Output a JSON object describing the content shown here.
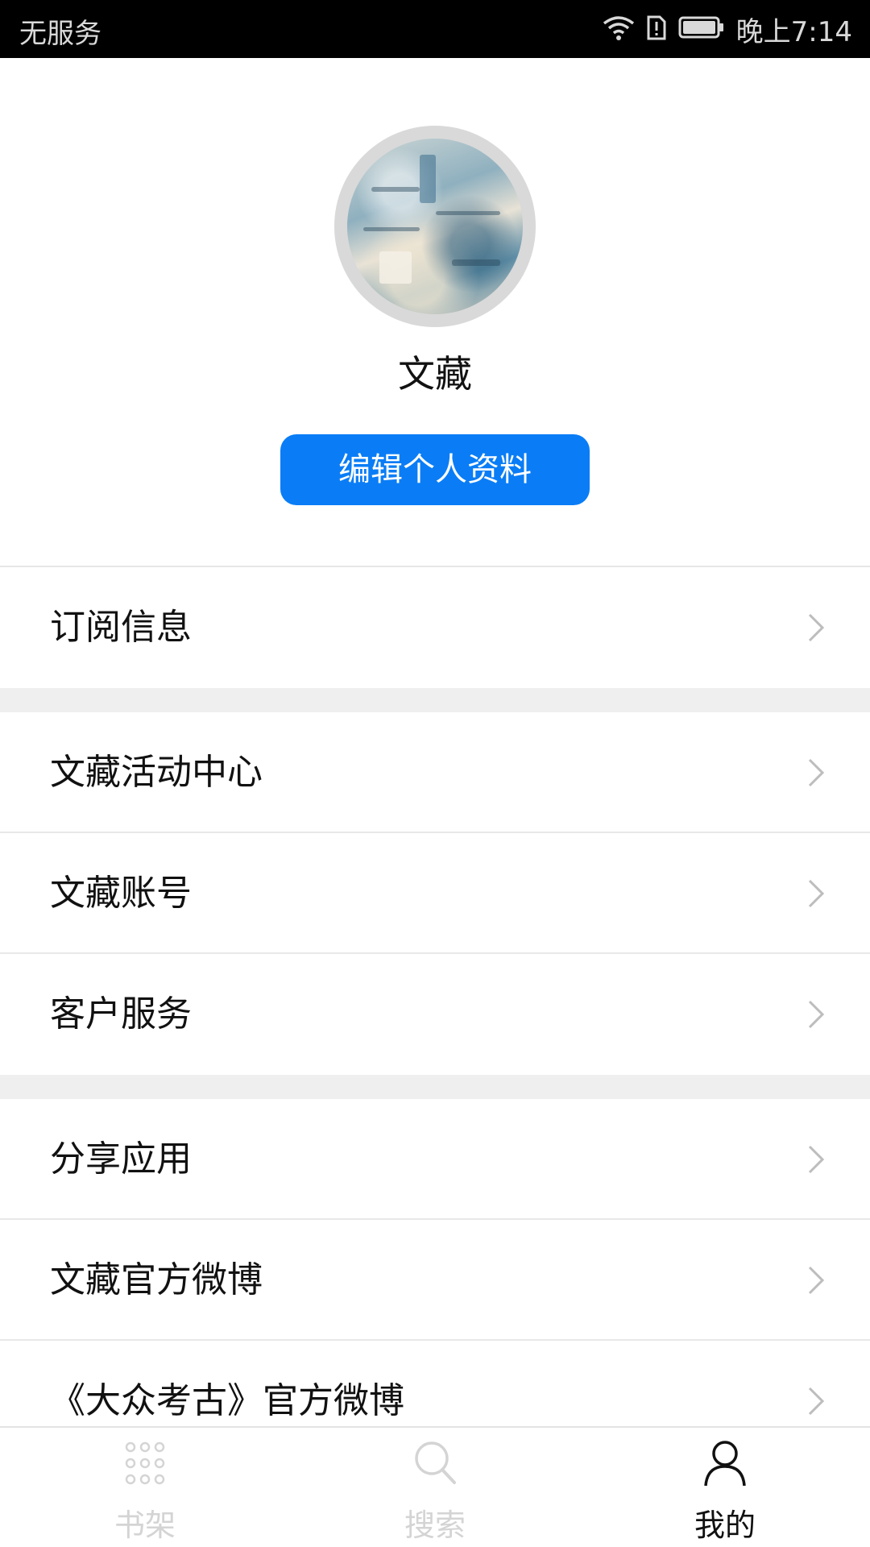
{
  "status_bar": {
    "carrier": "无服务",
    "time": "晚上7:14",
    "icons": [
      "wifi-icon",
      "sim-alert-icon",
      "battery-icon"
    ]
  },
  "profile": {
    "avatar": "avatar-painting",
    "username": "文藏",
    "edit_label": "编辑个人资料"
  },
  "menu": {
    "group1": [
      {
        "label": "订阅信息"
      }
    ],
    "group2": [
      {
        "label": "文藏活动中心"
      },
      {
        "label": "文藏账号"
      },
      {
        "label": "客户服务"
      }
    ],
    "group3": [
      {
        "label": "分享应用"
      },
      {
        "label": "文藏官方微博"
      },
      {
        "label": "《大众考古》官方微博"
      }
    ]
  },
  "bottom_nav": {
    "items": [
      {
        "label": "书架",
        "icon": "grid-dots-icon",
        "active": false
      },
      {
        "label": "搜索",
        "icon": "search-icon",
        "active": false
      },
      {
        "label": "我的",
        "icon": "person-icon",
        "active": true
      }
    ]
  },
  "colors": {
    "accent": "#0a7df6",
    "divider": "#efefef",
    "inactive_nav": "#d4d4d4"
  }
}
